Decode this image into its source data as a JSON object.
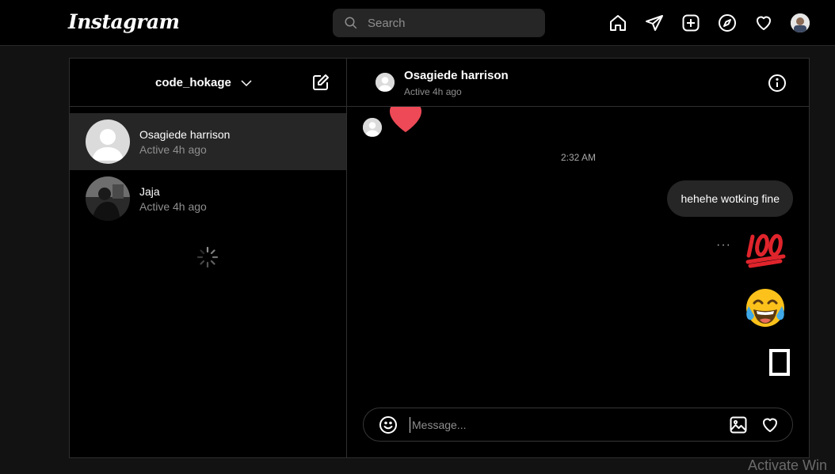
{
  "brand": {
    "logo_text": "Instagram"
  },
  "search": {
    "placeholder": "Search"
  },
  "nav": {
    "icons": [
      "home-icon",
      "direct-icon",
      "new-post-icon",
      "explore-icon",
      "activity-heart-icon",
      "profile-avatar"
    ]
  },
  "inbox": {
    "username": "code_hokage",
    "threads": [
      {
        "name": "Osagiede harrison",
        "status": "Active 4h ago",
        "active": true
      },
      {
        "name": "Jaja",
        "status": "Active 4h ago",
        "active": false
      }
    ]
  },
  "conversation": {
    "name": "Osagiede harrison",
    "status": "Active 4h ago",
    "timestamp": "2:32 AM",
    "sent_text": "hehehe wotking fine",
    "more_label": "···",
    "emojis": [
      "💯",
      "😂"
    ]
  },
  "composer": {
    "placeholder": "Message..."
  },
  "watermark": "Activate Win",
  "colors": {
    "background": "#121212",
    "panel": "#000000",
    "bubble": "#262626",
    "heart": "#ed4956"
  }
}
